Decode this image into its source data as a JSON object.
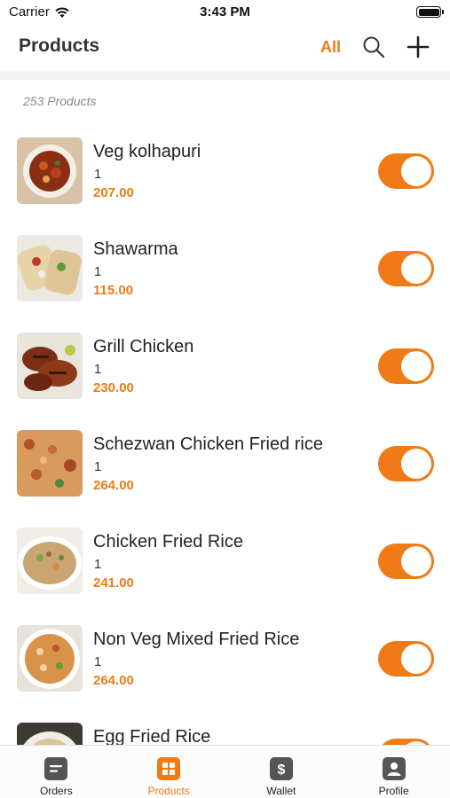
{
  "status_bar": {
    "carrier": "Carrier",
    "time": "3:43 PM"
  },
  "nav": {
    "title": "Products",
    "filter": "All"
  },
  "products_count": "253 Products",
  "products": [
    {
      "name": "Veg kolhapuri",
      "qty": "1",
      "price": "207.00",
      "enabled": true
    },
    {
      "name": "Shawarma",
      "qty": "1",
      "price": "115.00",
      "enabled": true
    },
    {
      "name": "Grill Chicken",
      "qty": "1",
      "price": "230.00",
      "enabled": true
    },
    {
      "name": "Schezwan Chicken Fried rice",
      "qty": "1",
      "price": "264.00",
      "enabled": true
    },
    {
      "name": "Chicken Fried Rice",
      "qty": "1",
      "price": "241.00",
      "enabled": true
    },
    {
      "name": "Non Veg Mixed Fried Rice",
      "qty": "1",
      "price": "264.00",
      "enabled": true
    },
    {
      "name": "Egg Fried Rice",
      "qty": "",
      "price": "",
      "enabled": true
    }
  ],
  "tabs": [
    {
      "label": "Orders",
      "icon": "orders-icon",
      "active": false
    },
    {
      "label": "Products",
      "icon": "products-icon",
      "active": true
    },
    {
      "label": "Wallet",
      "icon": "wallet-icon",
      "active": false
    },
    {
      "label": "Profile",
      "icon": "profile-icon",
      "active": false
    }
  ],
  "colors": {
    "accent": "#f07a16"
  }
}
